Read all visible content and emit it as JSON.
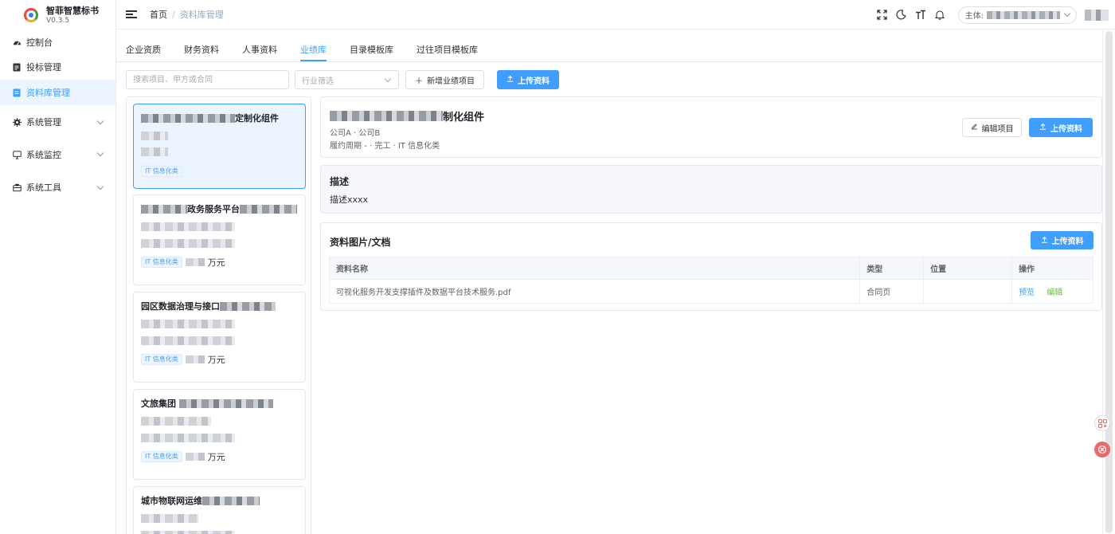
{
  "app": {
    "name": "智菲智慧标书",
    "version": "V0.3.5"
  },
  "sidebar": {
    "items": [
      {
        "label": "控制台",
        "icon": "dashboard-icon"
      },
      {
        "label": "投标管理",
        "icon": "document-icon"
      },
      {
        "label": "资料库管理",
        "icon": "database-icon",
        "active": true
      },
      {
        "label": "系统管理",
        "icon": "gear-icon",
        "expandable": true
      },
      {
        "label": "系统监控",
        "icon": "monitor-icon",
        "expandable": true
      },
      {
        "label": "系统工具",
        "icon": "toolbox-icon",
        "expandable": true
      }
    ]
  },
  "header": {
    "breadcrumb": [
      "首页",
      "资料库管理"
    ],
    "subject_label": "主体:",
    "icons": [
      "fullscreen-icon",
      "dark-mode-icon",
      "font-size-icon",
      "bell-icon"
    ]
  },
  "tabs": [
    "企业资质",
    "财务资料",
    "人事资料",
    "业绩库",
    "目录模板库",
    "过往项目模板库"
  ],
  "active_tab": "业绩库",
  "toolbar": {
    "search_placeholder": "搜索项目、甲方或合同",
    "industry_placeholder": "行业筛选",
    "add_label": "新增业绩项目",
    "upload_label": "上传资料"
  },
  "cards": [
    {
      "title_suffix": "定制化组件",
      "tag": "IT 信息化类",
      "amount": ""
    },
    {
      "title_mid": "政务服务平台",
      "tag": "IT 信息化类",
      "amount": "万元"
    },
    {
      "title_prefix": "园区数据治理与接口",
      "tag": "IT 信息化类",
      "amount": "万元"
    },
    {
      "title_prefix": "文旅集团",
      "tag": "IT 信息化类",
      "amount": "万元"
    },
    {
      "title_prefix": "城市物联网运维",
      "tag": "",
      "amount": ""
    }
  ],
  "detail": {
    "title_suffix": "制化组件",
    "parties": "公司A · 公司B",
    "period": "履约周期 - · 完工 · IT 信息化类",
    "edit_label": "编辑项目",
    "upload_label": "上传资料"
  },
  "description": {
    "heading": "描述",
    "text": "描述xxxx"
  },
  "files": {
    "heading": "资料图片/文档",
    "upload_label": "上传资料",
    "columns": [
      "资料名称",
      "类型",
      "位置",
      "操作"
    ],
    "rows": [
      {
        "name": "可视化服务开发支撑插件及数据平台技术服务.pdf",
        "type": "合同页",
        "position": "",
        "preview": "预览",
        "edit": "编辑"
      }
    ]
  },
  "colors": {
    "primary": "#409eff",
    "success": "#67c23a",
    "border": "#e4e7ed"
  }
}
